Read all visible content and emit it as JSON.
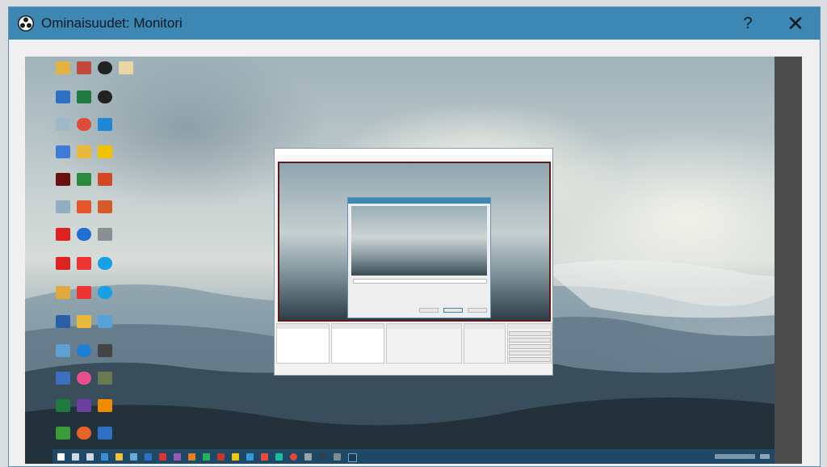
{
  "window": {
    "title": "Ominaisuudet: Monitori",
    "help_label": "?",
    "close_label": "✕",
    "app_icon": "obs-logo-icon"
  },
  "preview": {
    "description_icon": "desktop-capture-preview",
    "taskbar_icons": [
      "windows-start-icon",
      "search-icon",
      "task-view-icon",
      "edge-icon",
      "explorer-icon",
      "store-icon",
      "mail-icon",
      "chrome-icon",
      "obs-icon"
    ]
  },
  "colors": {
    "titlebar": "#3d87b4",
    "taskbar": "#1f4766",
    "preview_border": "#4c4c4c"
  }
}
